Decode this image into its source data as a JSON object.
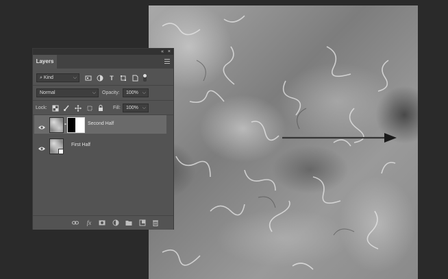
{
  "panel": {
    "tab_label": "Layers",
    "collapse_glyph": "«",
    "close_glyph": "×",
    "filter": {
      "kind_label": "Kind"
    },
    "blend": {
      "mode": "Normal",
      "opacity_label": "Opacity:",
      "opacity_value": "100%"
    },
    "lock": {
      "label": "Lock:",
      "fill_label": "Fill:",
      "fill_value": "100%"
    },
    "layers": [
      {
        "name": "Second Half",
        "selected": true,
        "visible": true,
        "has_mask": true
      },
      {
        "name": "First Half",
        "selected": false,
        "visible": true,
        "has_mask": false
      }
    ],
    "footer_icons": [
      "link-icon",
      "fx-icon",
      "add-mask-icon",
      "adjustment-icon",
      "folder-icon",
      "new-layer-icon",
      "trash-icon"
    ]
  },
  "canvas": {
    "arrow_direction": "right"
  }
}
